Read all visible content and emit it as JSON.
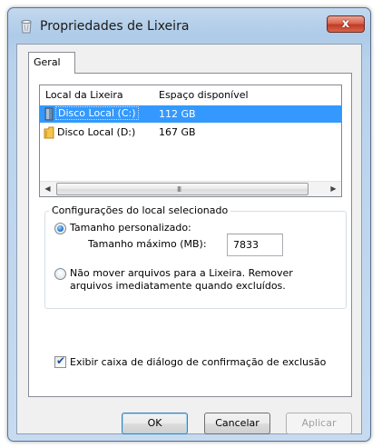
{
  "window": {
    "title": "Propriedades de Lixeira",
    "close_label": "x"
  },
  "tabs": [
    {
      "label": "Geral",
      "selected": true
    }
  ],
  "list": {
    "columns": [
      "Local da Lixeira",
      "Espaço disponível"
    ],
    "rows": [
      {
        "name": "Disco Local (C:)",
        "space": "112 GB",
        "selected": true,
        "icon": "drive-icon"
      },
      {
        "name": "Disco Local (D:)",
        "space": "167 GB",
        "selected": false,
        "icon": "folder-drive-icon"
      }
    ],
    "scroll_grip": "III"
  },
  "settings": {
    "group_label": "Configurações do local selecionado",
    "custom_size_label": "Tamanho personalizado:",
    "custom_size_checked": true,
    "max_size_label": "Tamanho máximo (MB):",
    "max_size_value": "7833",
    "no_move_label_line1": "Não mover arquivos para a Lixeira. Remover",
    "no_move_label_line2": "arquivos imediatamente quando excluídos.",
    "no_move_checked": false
  },
  "confirm": {
    "label": "Exibir caixa de diálogo de confirmação de exclusão",
    "checked": true
  },
  "buttons": {
    "ok": "OK",
    "cancel": "Cancelar",
    "apply": "Aplicar"
  },
  "colors": {
    "selection": "#3399ff",
    "close_button": "#c33a25"
  }
}
